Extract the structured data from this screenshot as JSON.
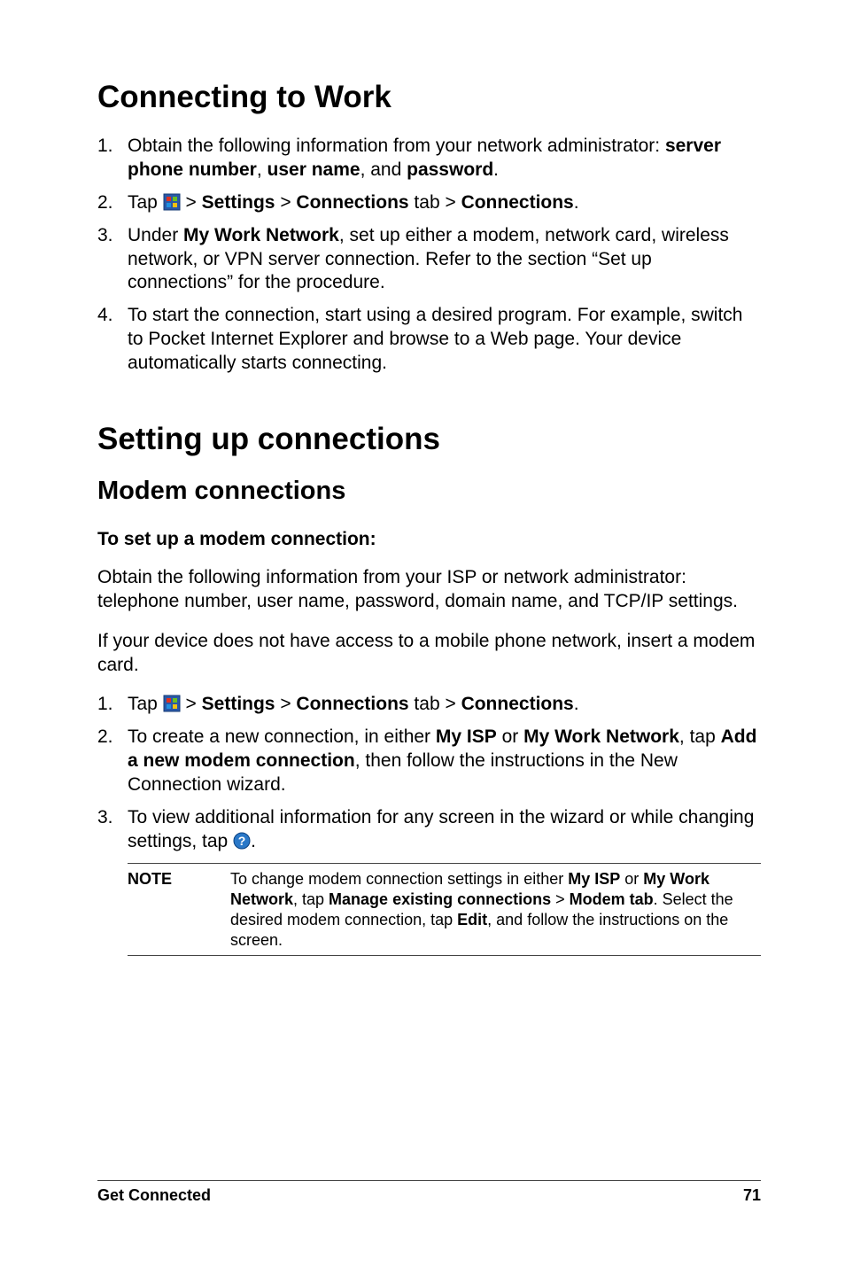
{
  "h1_1": "Connecting to Work",
  "list1": {
    "i1": {
      "num": "1.",
      "pre": "Obtain the following information from your network administrator: ",
      "b1": "server phone number",
      "sep1": ", ",
      "b2": "user name",
      "sep2": ", and ",
      "b3": "password",
      "post": "."
    },
    "i2": {
      "num": "2.",
      "pre": "Tap ",
      "gt1": " > ",
      "b1": "Settings",
      "gt2": " > ",
      "b2": "Connections",
      "mid": " tab > ",
      "b3": "Connections",
      "post": "."
    },
    "i3": {
      "num": "3.",
      "pre": "Under ",
      "b1": "My Work Network",
      "post": ", set up either a modem, network card, wireless network, or VPN server connection. Refer to the section “Set up connections” for the procedure."
    },
    "i4": {
      "num": "4.",
      "text": "To start the connection, start using a desired program. For example, switch to Pocket Internet Explorer and browse to a Web page. Your device automatically starts connecting."
    }
  },
  "h1_2": "Setting up connections",
  "h2_1": "Modem connections",
  "h3_1": "To set up a modem connection:",
  "p1": "Obtain the following information from your ISP or network administrator: telephone number, user name, password, domain name, and TCP/IP settings.",
  "p2": "If your device does not have access to a mobile phone network, insert a modem card.",
  "list2": {
    "i1": {
      "num": "1.",
      "pre": "Tap ",
      "gt1": "  > ",
      "b1": "Settings",
      "gt2": " > ",
      "b2": "Connections",
      "mid": " tab > ",
      "b3": "Connections",
      "post": "."
    },
    "i2": {
      "num": "2.",
      "pre": "To create a new connection, in either ",
      "b1": "My ISP",
      "or": " or ",
      "b2": "My Work Network",
      "mid": ", tap ",
      "b3": "Add a new modem connection",
      "post": ", then follow the instructions in the New Connection wizard."
    },
    "i3": {
      "num": "3.",
      "pre": "To view additional information for any screen in the wizard or while changing settings, tap ",
      "post": "."
    }
  },
  "note": {
    "label": "NOTE",
    "pre": "To change modem connection settings in either ",
    "b1": "My ISP",
    "or": " or ",
    "b2": "My Work Network",
    "mid1": ", tap ",
    "b3": "Manage existing connections",
    "gt": " > ",
    "b4": "Modem tab",
    "mid2": ". Select the desired modem connection, tap ",
    "b5": "Edit",
    "post": ", and follow the instructions on the screen."
  },
  "footer": {
    "left": "Get Connected",
    "right": "71"
  },
  "icons": {
    "start": "start-icon",
    "help": "help-icon"
  }
}
